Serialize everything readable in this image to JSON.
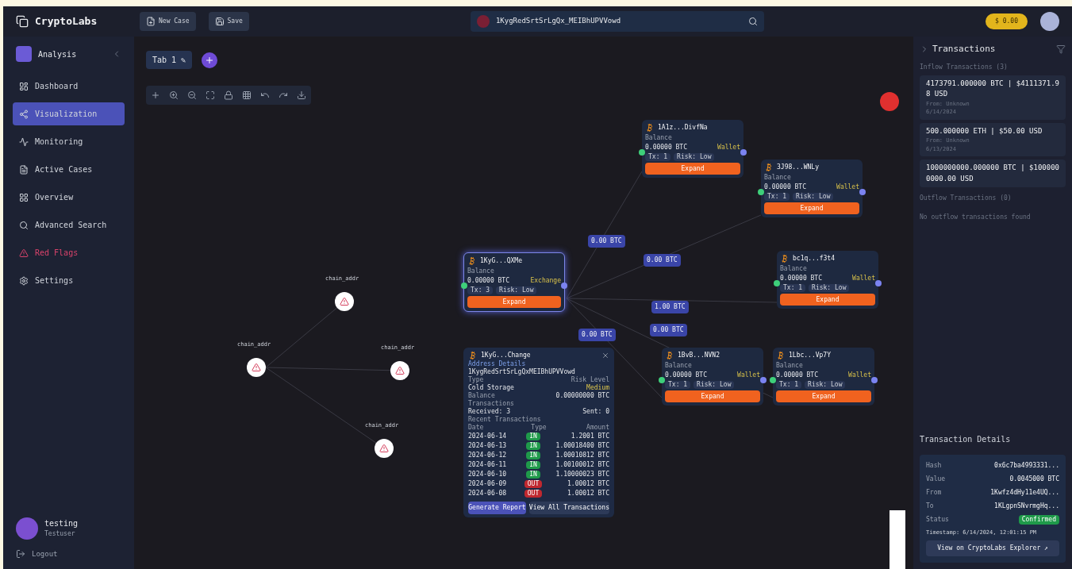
{
  "app": {
    "name": "CryptoLabs",
    "buttons": [
      "New Case",
      "Save"
    ],
    "search": {
      "value": "1KygRedSrtSrLgQx_MEIBhUPVVowd"
    },
    "balance": "$ 0.00"
  },
  "sidebar": {
    "workspace": "Analysis",
    "items": [
      {
        "label": "Dashboard",
        "selected": false,
        "kind": "normal"
      },
      {
        "label": "Visualization",
        "selected": true,
        "kind": "normal"
      },
      {
        "label": "Monitoring",
        "selected": false,
        "kind": "normal"
      },
      {
        "label": "Active Cases",
        "selected": false,
        "kind": "normal"
      },
      {
        "label": "Overview",
        "selected": false,
        "kind": "normal"
      },
      {
        "label": "Advanced Search",
        "selected": false,
        "kind": "normal"
      },
      {
        "label": "Red Flags",
        "selected": false,
        "kind": "alert"
      },
      {
        "label": "Settings",
        "selected": false,
        "kind": "normal"
      }
    ],
    "user": {
      "name": "testing",
      "role": "Testuser"
    },
    "logout": "Logout"
  },
  "canvas": {
    "tab": "Tab 1 ✎",
    "graph_nodes": [
      {
        "label": "chain_addr"
      },
      {
        "label": "chain_addr"
      },
      {
        "label": "chain_addr"
      },
      {
        "label": "chain_addr"
      }
    ],
    "edge_labels": [
      "0.00 BTC",
      "0.00 BTC",
      "1.00 BTC",
      "0.00 BTC",
      "0.00 BTC"
    ],
    "cards": [
      {
        "title": "1KyG...QXMe",
        "field": "Balance",
        "value": "0.00000 BTC",
        "tag": "Exchange",
        "chip_1": "Tx: 3",
        "chip_2": "Risk: Low",
        "button": "Expand",
        "selected": true
      },
      {
        "title": "1A1z...DivfNa",
        "field": "Balance",
        "value": "0.00000 BTC",
        "tag": "Wallet",
        "chip_1": "Tx: 1",
        "chip_2": "Risk: Low",
        "button": "Expand",
        "selected": false
      },
      {
        "title": "3J98...WNLy",
        "field": "Balance",
        "value": "0.00000 BTC",
        "tag": "Wallet",
        "chip_1": "Tx: 1",
        "chip_2": "Risk: Low",
        "button": "Expand",
        "selected": false
      },
      {
        "title": "bc1q...f3t4",
        "field": "Balance",
        "value": "0.00000 BTC",
        "tag": "Wallet",
        "chip_1": "Tx: 1",
        "chip_2": "Risk: Low",
        "button": "Expand",
        "selected": false
      },
      {
        "title": "1BvB...NVN2",
        "field": "Balance",
        "value": "0.00000 BTC",
        "tag": "Wallet",
        "chip_1": "Tx: 1",
        "chip_2": "Risk: Low",
        "button": "Expand",
        "selected": false
      },
      {
        "title": "1Lbc...Vp7Y",
        "field": "Balance",
        "value": "0.00000 BTC",
        "tag": "Wallet",
        "chip_1": "Tx: 1",
        "chip_2": "Risk: Low",
        "button": "Expand",
        "selected": false
      }
    ],
    "detail": {
      "title": "1KyG...Change",
      "address_label": "Address Details",
      "address": "1KygRedSrtSrLgQxMEIBhUPVVowd",
      "type_label": "Type",
      "type": "Cold Storage",
      "risk_label": "Risk Level",
      "risk": "Medium",
      "balance_label": "Balance",
      "balance": "0.00000000 BTC",
      "stats_label": "Transactions",
      "received": "Received: 3",
      "sent": "Sent: 0",
      "recent_label": "Recent Transactions",
      "columns": [
        "Date",
        "Type",
        "Amount"
      ],
      "rows": [
        {
          "date": "2024-06-14",
          "type": "IN",
          "kind": "in",
          "amount": "1.2001 BTC"
        },
        {
          "date": "2024-06-13",
          "type": "IN",
          "kind": "in",
          "amount": "1.00018400 BTC"
        },
        {
          "date": "2024-06-12",
          "type": "IN",
          "kind": "in",
          "amount": "1.00010812 BTC"
        },
        {
          "date": "2024-06-11",
          "type": "IN",
          "kind": "in",
          "amount": "1.00100012 BTC"
        },
        {
          "date": "2024-06-10",
          "type": "IN",
          "kind": "in",
          "amount": "1.10000023 BTC"
        },
        {
          "date": "2024-06-09",
          "type": "OUT",
          "kind": "out",
          "amount": "1.00012 BTC"
        },
        {
          "date": "2024-06-08",
          "type": "OUT",
          "kind": "out",
          "amount": "1.00012 BTC"
        }
      ],
      "actions": [
        "Generate Report",
        "View All Transactions"
      ]
    }
  },
  "transactions": {
    "title": "Transactions",
    "inflow_label": "Inflow Transactions (3)",
    "inflow": [
      {
        "amount": "4173791.000000 BTC | $4111371.98 USD",
        "from": "From: Unknown",
        "time": "6/14/2024"
      },
      {
        "amount": "500.000000 ETH | $50.00 USD",
        "from": "From: Unknown",
        "time": "6/13/2024"
      },
      {
        "amount": "1000000000.000000 BTC | $1000000000.00 USD"
      }
    ],
    "outflow_label": "Outflow Transactions (0)",
    "outflow_empty": "No outflow transactions found",
    "details_title": "Transaction Details",
    "details": [
      {
        "label": "Hash",
        "value": "0x6c7ba4993331..."
      },
      {
        "label": "Value",
        "value": "0.0045000 BTC"
      },
      {
        "label": "From",
        "value": "1Kwfz4dHy11e4UQ..."
      },
      {
        "label": "To",
        "value": "1KLgpnSNvrmgHq..."
      }
    ],
    "status_label": "Status",
    "status": "Confirmed",
    "timestamp": "Timestamp: 6/14/2024, 12:01:15 PM",
    "explorer": "View on CryptoLabs Explorer ↗"
  }
}
